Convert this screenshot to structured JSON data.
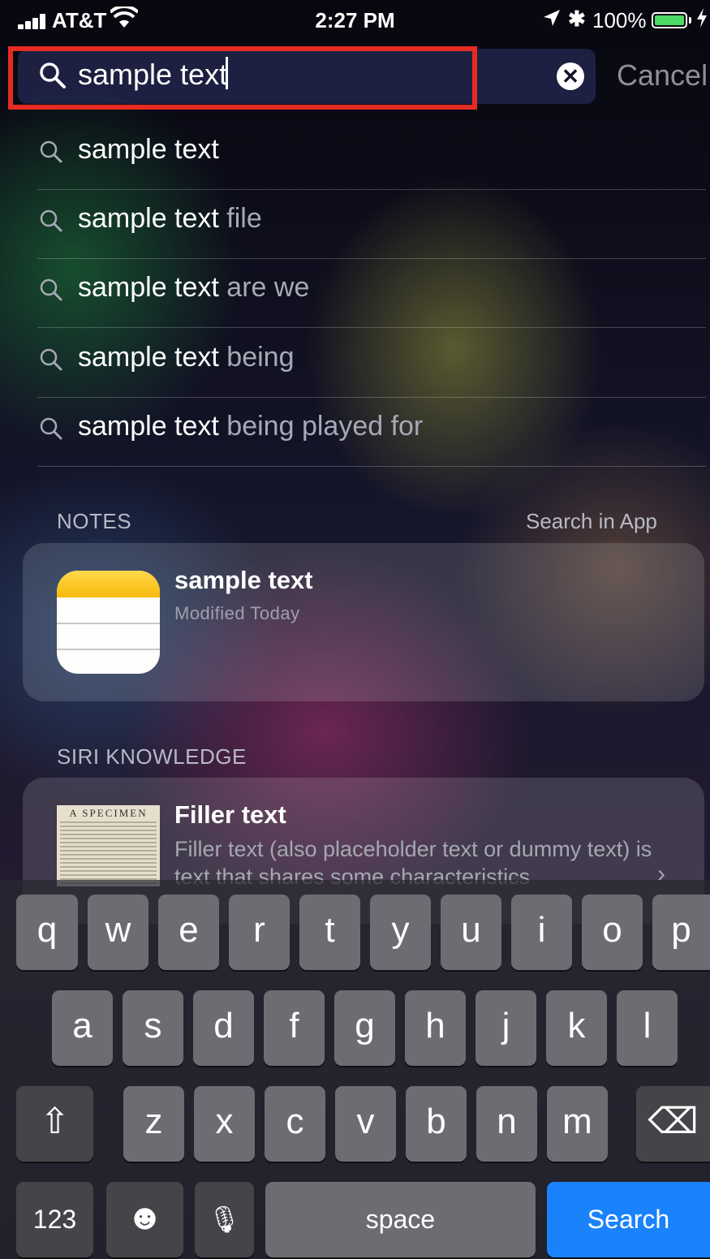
{
  "status_bar": {
    "carrier": "AT&T",
    "time": "2:27 PM",
    "battery_percent": "100%",
    "bluetooth_glyph": "✱",
    "icons": [
      "signal-icon",
      "wifi-icon",
      "location-arrow-icon",
      "bluetooth-icon",
      "battery-icon",
      "charging-bolt-icon"
    ]
  },
  "search": {
    "query": "sample text",
    "cancel_label": "Cancel",
    "clear_glyph": "✕",
    "highlight_color": "#e52b22"
  },
  "suggestions": [
    {
      "match": "sample text",
      "completion": ""
    },
    {
      "match": "sample text",
      "completion": " file"
    },
    {
      "match": "sample text",
      "completion": " are we"
    },
    {
      "match": "sample text",
      "completion": " being"
    },
    {
      "match": "sample text",
      "completion": " being played for"
    }
  ],
  "notes_section": {
    "title": "NOTES",
    "link": "Search in App",
    "result": {
      "title": "sample text",
      "subtitle": "Modified Today"
    }
  },
  "siri_section": {
    "title": "SIRI KNOWLEDGE",
    "result": {
      "title": "Filler text",
      "description": "Filler text (also placeholder text or dummy text) is text that shares some characteristics",
      "thumbnail_heading": "A SPECIMEN",
      "chevron": "›"
    }
  },
  "keyboard": {
    "row1": [
      "q",
      "w",
      "e",
      "r",
      "t",
      "y",
      "u",
      "i",
      "o",
      "p"
    ],
    "row2": [
      "a",
      "s",
      "d",
      "f",
      "g",
      "h",
      "j",
      "k",
      "l"
    ],
    "row3": [
      "z",
      "x",
      "c",
      "v",
      "b",
      "n",
      "m"
    ],
    "shift_glyph": "⇧",
    "delete_glyph": "⌫",
    "numbers_label": "123",
    "emoji_glyph": "☻",
    "mic_glyph": "🎙",
    "space_label": "space",
    "search_label": "Search",
    "accent_color": "#1a82fb"
  }
}
